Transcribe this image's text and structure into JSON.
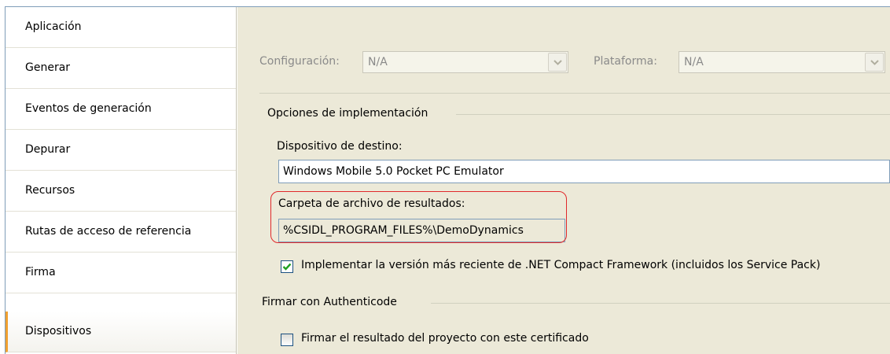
{
  "sidebar": {
    "items": [
      {
        "label": "Aplicación",
        "active": false
      },
      {
        "label": "Generar",
        "active": false
      },
      {
        "label": "Eventos de generación",
        "active": false
      },
      {
        "label": "Depurar",
        "active": false
      },
      {
        "label": "Recursos",
        "active": false
      },
      {
        "label": "Rutas de acceso de referencia",
        "active": false
      },
      {
        "label": "Firma",
        "active": false
      },
      {
        "label": "Dispositivos",
        "active": true
      }
    ]
  },
  "config": {
    "configuration_label": "Configuración:",
    "configuration_value": "N/A",
    "platform_label": "Plataforma:",
    "platform_value": "N/A"
  },
  "deployment": {
    "group_label": "Opciones de implementación",
    "target_device_label": "Dispositivo de destino:",
    "target_device_value": "Windows Mobile 5.0 Pocket PC Emulator",
    "output_folder_label": "Carpeta de archivo de resultados:",
    "output_folder_value": "%CSIDL_PROGRAM_FILES%\\DemoDynamics",
    "deploy_latest_label": "Implementar la versión más reciente de .NET Compact Framework (incluidos los Service Pack)",
    "deploy_latest_checked": true
  },
  "authenticode": {
    "group_label": "Firmar con Authenticode",
    "sign_label": "Firmar el resultado del proyecto con este certificado",
    "sign_checked": false
  },
  "colors": {
    "active_tab_marker": "#f0a030",
    "highlight_outline": "#e0292b",
    "panel_background": "#ece9d8"
  }
}
